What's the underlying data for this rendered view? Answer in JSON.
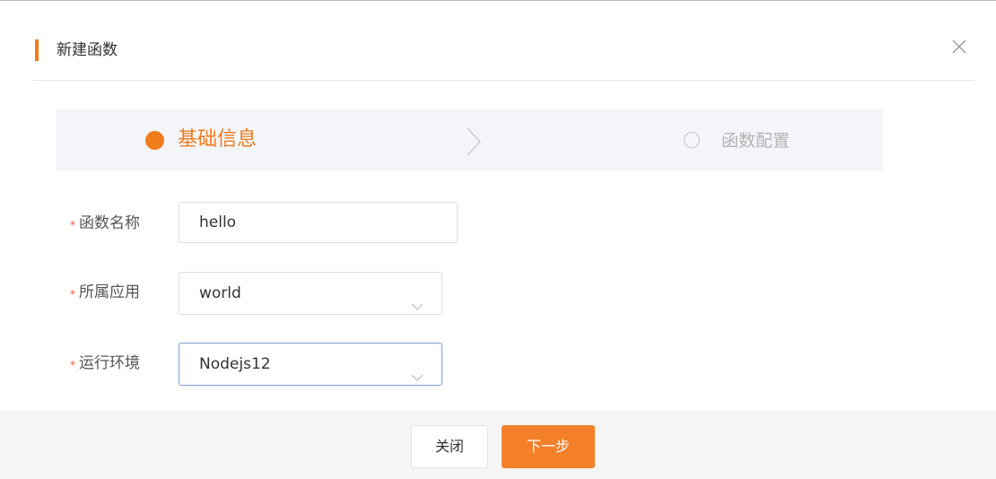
{
  "dialog": {
    "title": "新建函数",
    "accent_color": "#f07c1c",
    "close_icon": "close-icon"
  },
  "steps": [
    {
      "label": "基础信息",
      "state": "active"
    },
    {
      "label": "函数配置",
      "state": "inactive"
    }
  ],
  "form": {
    "required_mark": "*",
    "fields": [
      {
        "label": "函数名称",
        "value": "hello",
        "type": "text"
      },
      {
        "label": "所属应用",
        "value": "world",
        "type": "select"
      },
      {
        "label": "运行环境",
        "value": "Nodejs12",
        "type": "select",
        "focused": true
      }
    ]
  },
  "footer": {
    "close_label": "关闭",
    "next_label": "下一步"
  }
}
